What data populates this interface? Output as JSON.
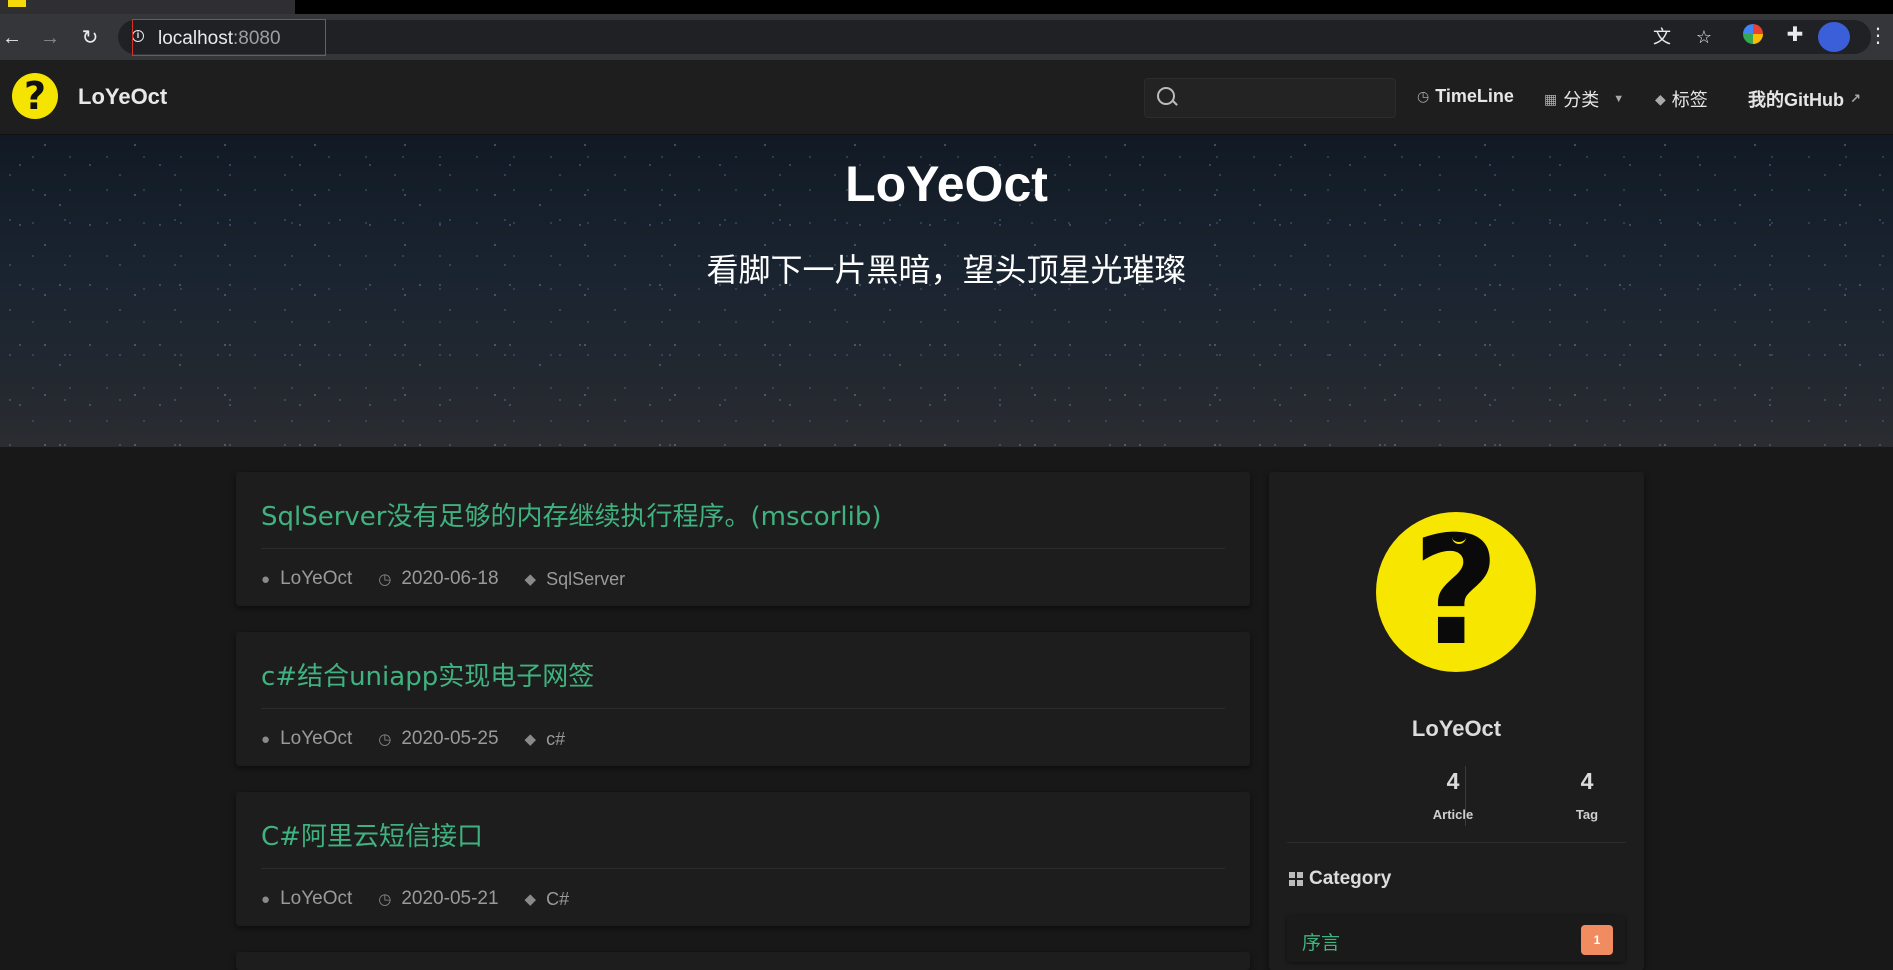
{
  "browser": {
    "url_host": "localhost",
    "url_port": ":8080",
    "back_icon": "arrow-left",
    "forward_icon": "arrow-right",
    "reload_icon": "reload",
    "translate_icon": "translate",
    "star_icon": "star"
  },
  "nav": {
    "brand": "LoYeOct",
    "search_placeholder": "",
    "links": {
      "timeline": "TimeLine",
      "category": "分类",
      "tags": "标签",
      "github": "我的GitHub"
    }
  },
  "hero": {
    "title": "LoYeOct",
    "subtitle": "看脚下一片黑暗，望头顶星光璀璨"
  },
  "posts": [
    {
      "title": "SqlServer没有足够的内存继续执行程序。(mscorlib)",
      "author": "LoYeOct",
      "date": "2020-06-18",
      "tag": "SqlServer"
    },
    {
      "title": "c#结合uniapp实现电子网签",
      "author": "LoYeOct",
      "date": "2020-05-25",
      "tag": "c#"
    },
    {
      "title": "C#阿里云短信接口",
      "author": "LoYeOct",
      "date": "2020-05-21",
      "tag": "C#"
    }
  ],
  "sidebar": {
    "name": "LoYeOct",
    "article_count": "4",
    "article_label": "Article",
    "tag_count": "4",
    "tag_label": "Tag",
    "category_heading": "Category",
    "categories": [
      {
        "label": "序言",
        "count": "1"
      }
    ]
  },
  "colors": {
    "accent_green": "#3fb27f",
    "badge_orange": "#f08c5f",
    "logo_yellow": "#f5e400"
  }
}
